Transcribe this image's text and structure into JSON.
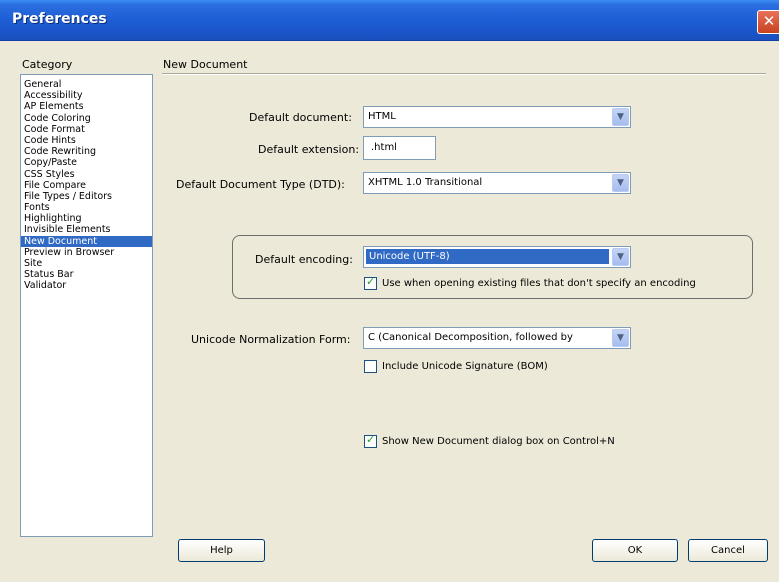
{
  "window": {
    "title": "Preferences",
    "close_glyph": "✕"
  },
  "category": {
    "label": "Category",
    "items": [
      {
        "label": "General"
      },
      {
        "label": "Accessibility"
      },
      {
        "label": "AP Elements"
      },
      {
        "label": "Code Coloring"
      },
      {
        "label": "Code Format"
      },
      {
        "label": "Code Hints"
      },
      {
        "label": "Code Rewriting"
      },
      {
        "label": "Copy/Paste"
      },
      {
        "label": "CSS Styles"
      },
      {
        "label": "File Compare"
      },
      {
        "label": "File Types / Editors"
      },
      {
        "label": "Fonts"
      },
      {
        "label": "Highlighting"
      },
      {
        "label": "Invisible Elements"
      },
      {
        "label": "New Document"
      },
      {
        "label": "Preview in Browser"
      },
      {
        "label": "Site"
      },
      {
        "label": "Status Bar"
      },
      {
        "label": "Validator"
      }
    ],
    "selected": "New Document"
  },
  "section": {
    "title": "New Document"
  },
  "fields": {
    "default_document": {
      "label": "Default document:",
      "value": "HTML"
    },
    "default_extension": {
      "label": "Default extension:",
      "value": ".html"
    },
    "dtd": {
      "label": "Default Document Type (DTD):",
      "value": "XHTML 1.0 Transitional"
    },
    "encoding": {
      "label": "Default encoding:",
      "value": "Unicode (UTF-8)"
    },
    "use_when_opening": {
      "label": "Use when opening existing files that don't specify an encoding",
      "checked": true
    },
    "normalization": {
      "label": "Unicode Normalization Form:",
      "value": "C (Canonical Decomposition, followed by"
    },
    "include_bom": {
      "label": "Include Unicode Signature (BOM)",
      "checked": false
    },
    "show_dialog": {
      "label": "Show New Document dialog box on Control+N",
      "checked": true
    }
  },
  "buttons": {
    "help": "Help",
    "ok": "OK",
    "cancel": "Cancel"
  },
  "icons": {
    "dropdown_arrow": "chevron-down-icon",
    "check": "checkmark-icon"
  },
  "colors": {
    "titlebar": "#1f5fd6",
    "selection": "#316ac5",
    "window_bg": "#ece9d8"
  }
}
